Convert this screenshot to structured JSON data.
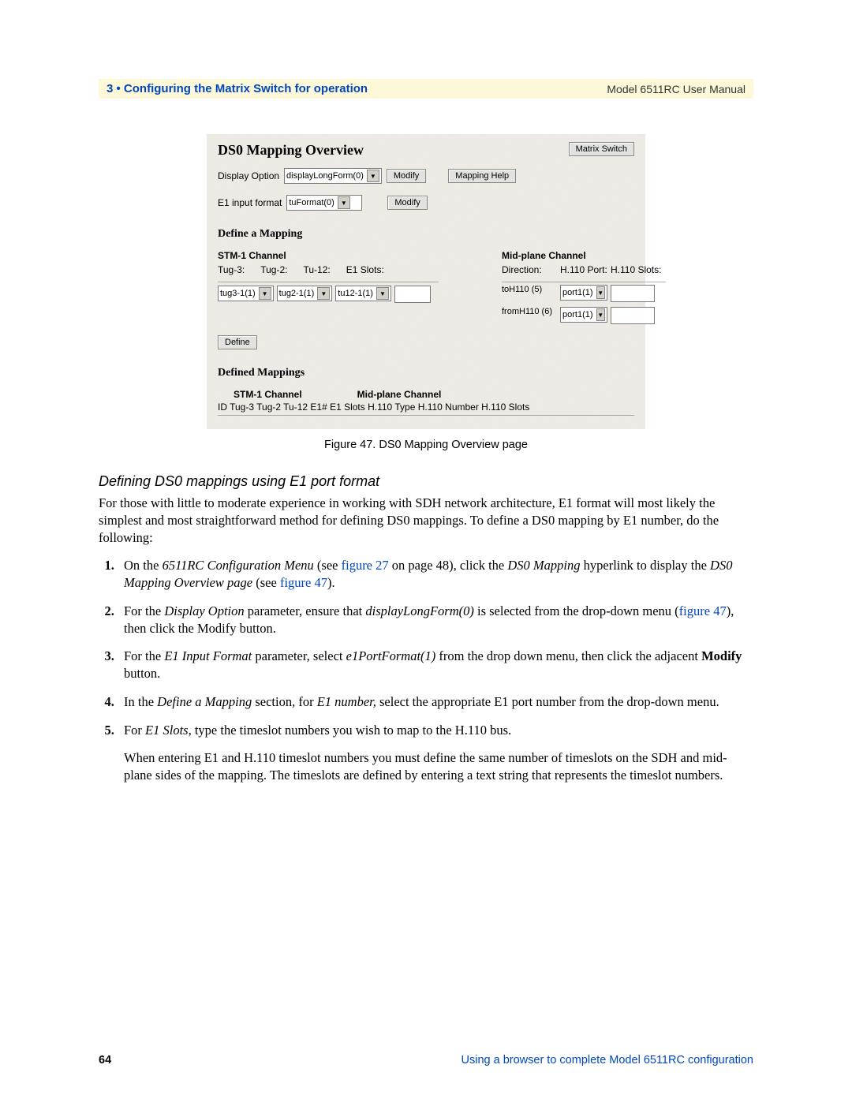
{
  "header": {
    "chapter": "3 • Configuring the Matrix Switch for operation",
    "doc_title": "Model 6511RC User Manual"
  },
  "screenshot": {
    "title": "DS0 Mapping Overview",
    "matrix_switch_btn": "Matrix Switch",
    "display_option_label": "Display Option",
    "display_option_value": "displayLongForm(0)",
    "modify_btn": "Modify",
    "mapping_help_btn": "Mapping Help",
    "e1_input_label": "E1 input format",
    "e1_input_value": "tuFormat(0)",
    "define_heading": "Define a Mapping",
    "stm1_heading": "STM-1 Channel",
    "midplane_heading": "Mid-plane Channel",
    "stm1_cols": {
      "tug3": "Tug-3:",
      "tug2": "Tug-2:",
      "tu12": "Tu-12:",
      "e1slots": "E1 Slots:"
    },
    "mid_cols": {
      "direction": "Direction:",
      "port": "H.110 Port:",
      "slots": "H.110 Slots:"
    },
    "tug3_val": "tug3-1(1)",
    "tug2_val": "tug2-1(1)",
    "tu12_val": "tu12-1(1)",
    "dir_to": "toH110 (5)",
    "dir_from": "fromH110 (6)",
    "port_val": "port1(1)",
    "define_btn": "Define",
    "defmap_heading": "Defined Mappings",
    "tbl": {
      "stm1": "STM-1 Channel",
      "mid": "Mid-plane Channel",
      "row": "ID Tug-3 Tug-2 Tu-12 E1# E1 Slots H.110 Type H.110 Number H.110 Slots"
    }
  },
  "caption": "Figure 47. DS0 Mapping Overview page",
  "subsection": "Defining DS0 mappings using E1 port format",
  "intro": "For those with little to moderate experience in working with SDH network architecture, E1 format will most likely the simplest and most straightforward method for defining DS0 mappings. To define a DS0 mapping by E1 number, do the following:",
  "steps": [
    {
      "pre1": "On the ",
      "em1": "6511RC Configuration Menu",
      "mid1": " (see ",
      "link1": "figure 27",
      "mid2": " on page 48), click the ",
      "em2": "DS0 Mapping",
      "mid3": " hyperlink to display the ",
      "em3": "DS0 Mapping Overview page",
      "mid4": " (see ",
      "link2": "figure 47",
      "end": ")."
    },
    {
      "pre1": "For the ",
      "em1": "Display Option",
      "mid1": " parameter, ensure that ",
      "em2": "displayLongForm(0)",
      "mid2": " is selected from the drop-down menu (",
      "link1": "figure 47",
      "end": "), then click the Modify button."
    },
    {
      "pre1": "For the ",
      "em1": "E1 Input Format",
      "mid1": " parameter, select ",
      "em2": "e1PortFormat(1)",
      "mid2": " from the drop down menu, then click the adjacent ",
      "strong": "Modify",
      "end": " button."
    },
    {
      "pre1": "In the ",
      "em1": "Define a Mapping",
      "mid1": " section, for ",
      "em2": "E1 number,",
      "end": " select the appropriate E1 port number from the drop-down menu."
    },
    {
      "pre1": "For ",
      "em1": "E1 Slots",
      "end": ", type the timeslot numbers you wish to map to the H.110 bus.",
      "sub": "When entering E1 and H.110 timeslot numbers you must define the same number of timeslots on the SDH and mid-plane sides of the mapping. The timeslots are defined by entering a text string that represents the timeslot numbers."
    }
  ],
  "footer": {
    "page": "64",
    "right": "Using a browser to complete Model 6511RC configuration"
  }
}
